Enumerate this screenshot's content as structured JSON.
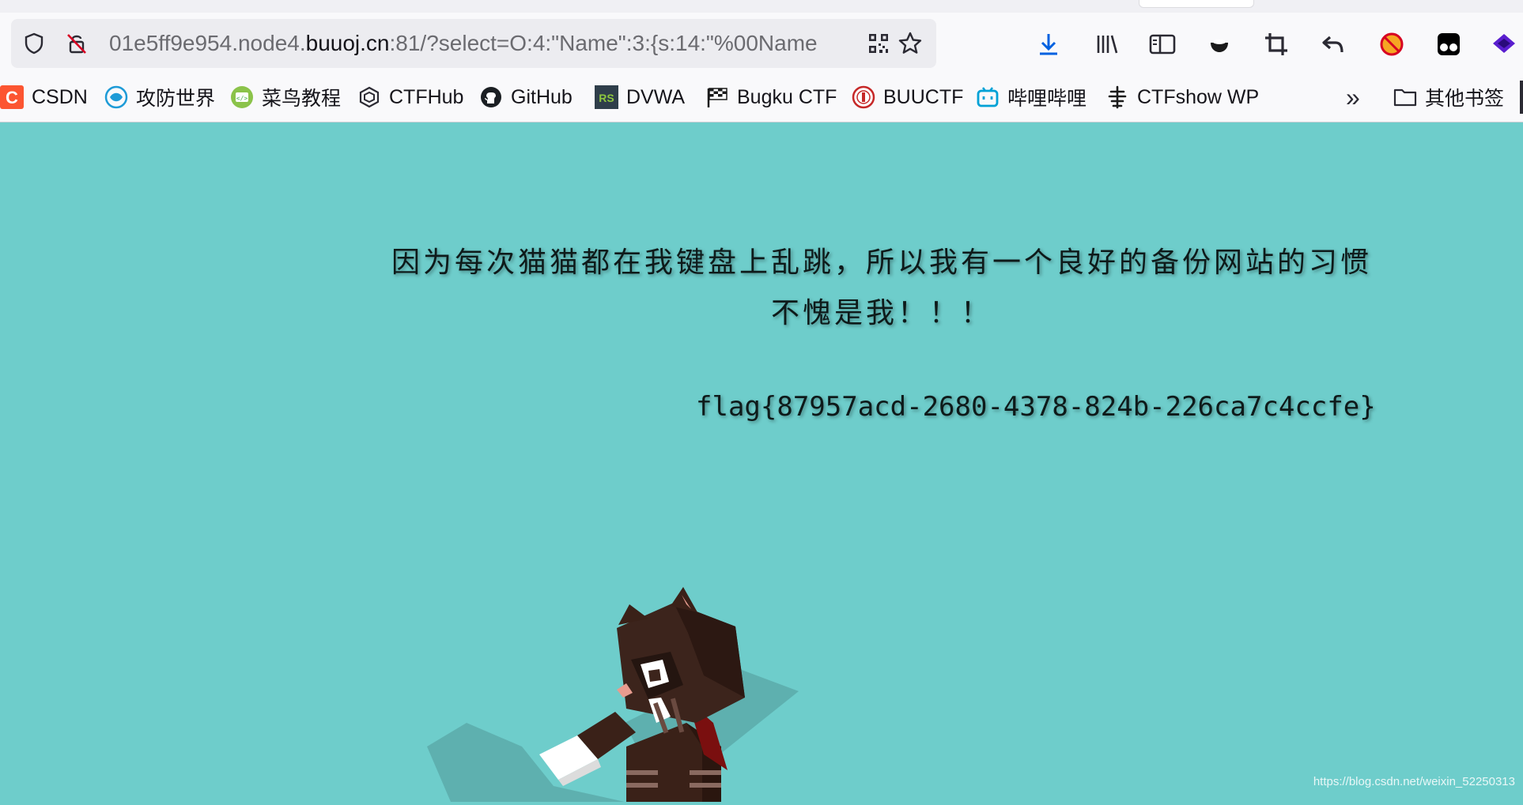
{
  "browser": {
    "url_prefix": "01e5ff9e954.node4.",
    "url_host": "buuoj.cn",
    "url_suffix": ":81/?select=O:4:\"Name\":3:{s:14:\"%00Name",
    "icons": {
      "shield": "shield-icon",
      "insecure": "insecure-lock-icon",
      "qr": "qr-code-icon",
      "star": "bookmark-star-icon",
      "download": "download-icon",
      "library": "library-icon",
      "sidebar": "sidebar-icon",
      "crop": "screenshot-crop-icon",
      "undo": "back-undo-icon"
    }
  },
  "bookmarks": {
    "items": [
      {
        "label": "CSDN",
        "icon": "csdn-icon"
      },
      {
        "label": "攻防世界",
        "icon": "adworld-icon"
      },
      {
        "label": "菜鸟教程",
        "icon": "runoob-icon"
      },
      {
        "label": "CTFHub",
        "icon": "ctfhub-icon"
      },
      {
        "label": "GitHub",
        "icon": "github-icon"
      },
      {
        "label": "DVWA",
        "icon": "dvwa-icon"
      },
      {
        "label": "Bugku CTF",
        "icon": "bugku-flag-icon"
      },
      {
        "label": "BUUCTF",
        "icon": "buuctf-icon"
      },
      {
        "label": "哔哩哔哩",
        "icon": "bilibili-icon"
      },
      {
        "label": "CTFshow WP",
        "icon": "ctfshow-icon"
      }
    ],
    "overflow_label": "»",
    "other_label": "其他书签"
  },
  "page": {
    "line1": "因为每次猫猫都在我键盘上乱跳，所以我有一个良好的备份网站的习惯",
    "line2": "不愧是我！！！",
    "flag": "flag{87957acd-2680-4378-824b-226ca7c4ccfe}",
    "watermark": "https://blog.csdn.net/weixin_52250313"
  },
  "colors": {
    "page_bg": "#6ecdcb",
    "text": "#0e1a1a",
    "download_blue": "#0061e0"
  }
}
